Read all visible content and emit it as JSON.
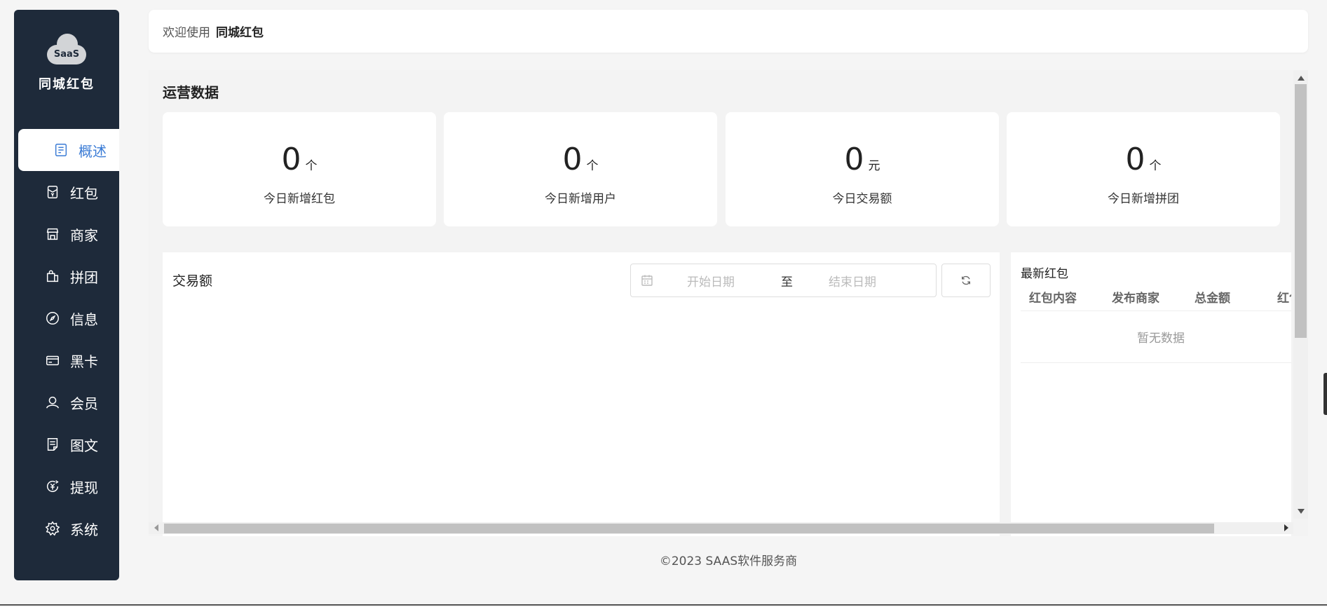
{
  "sidebar": {
    "logo_text": "SaaS",
    "brand": "同城红包",
    "items": [
      {
        "label": "概述",
        "icon": "overview-icon"
      },
      {
        "label": "红包",
        "icon": "red-packet-icon"
      },
      {
        "label": "商家",
        "icon": "store-icon"
      },
      {
        "label": "拼团",
        "icon": "shopping-bag-icon"
      },
      {
        "label": "信息",
        "icon": "compass-icon"
      },
      {
        "label": "黑卡",
        "icon": "card-icon"
      },
      {
        "label": "会员",
        "icon": "user-icon"
      },
      {
        "label": "图文",
        "icon": "document-icon"
      },
      {
        "label": "提现",
        "icon": "withdraw-icon"
      },
      {
        "label": "系统",
        "icon": "gear-icon"
      }
    ]
  },
  "header": {
    "welcome": "欢迎使用",
    "app_name": "同城红包"
  },
  "main": {
    "section_title": "运营数据",
    "stats": [
      {
        "value": "0",
        "unit": "个",
        "label": "今日新增红包"
      },
      {
        "value": "0",
        "unit": "个",
        "label": "今日新增用户"
      },
      {
        "value": "0",
        "unit": "元",
        "label": "今日交易额"
      },
      {
        "value": "0",
        "unit": "个",
        "label": "今日新增拼团"
      }
    ],
    "chart": {
      "title": "交易额",
      "start_placeholder": "开始日期",
      "separator": "至",
      "end_placeholder": "结束日期"
    },
    "table": {
      "title": "最新红包",
      "columns": [
        "红包内容",
        "发布商家",
        "总金额",
        "红包"
      ],
      "empty_text": "暂无数据"
    }
  },
  "footer": {
    "copyright": "©2023 SAAS软件服务商"
  },
  "colors": {
    "sidebar_bg": "#1e2a3a",
    "accent": "#3a7bd5"
  }
}
